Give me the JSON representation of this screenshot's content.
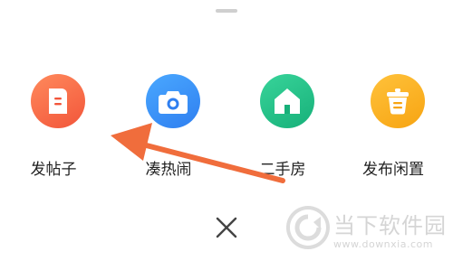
{
  "actions": [
    {
      "label": "发帖子",
      "icon": "post-icon",
      "color": "#f2553a"
    },
    {
      "label": "凑热闹",
      "icon": "camera-icon",
      "color": "#2f7ff0"
    },
    {
      "label": "二手房",
      "icon": "house-icon",
      "color": "#17b079"
    },
    {
      "label": "发布闲置",
      "icon": "basket-icon",
      "color": "#f7a412"
    }
  ],
  "close_icon": "close-icon",
  "annotation": {
    "icon": "arrow-icon",
    "color": "#f06d3c"
  },
  "watermark": {
    "title": "当下软件园",
    "url": "www.downxia.com"
  }
}
